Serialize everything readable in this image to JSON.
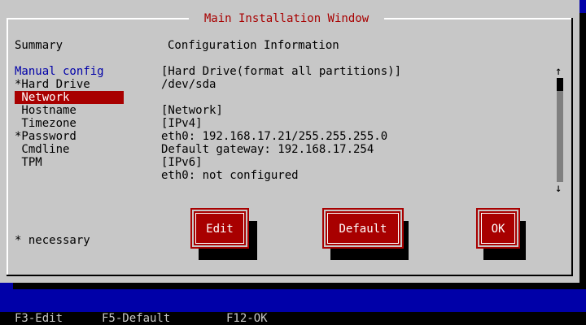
{
  "window": {
    "title": "Main Installation Window"
  },
  "headers": {
    "summary": "Summary",
    "config_info": "Configuration Information"
  },
  "summary_items": [
    {
      "label": "Manual config"
    },
    {
      "label": "*Hard Drive"
    },
    {
      "label": " Network"
    },
    {
      "label": " Hostname"
    },
    {
      "label": " Timezone"
    },
    {
      "label": "*Password"
    },
    {
      "label": " Cmdline"
    },
    {
      "label": " TPM"
    }
  ],
  "info_lines": [
    "[Hard Drive(format all partitions)]",
    "/dev/sda",
    "",
    "[Network]",
    "[IPv4]",
    "eth0: 192.168.17.21/255.255.255.0",
    "Default gateway: 192.168.17.254",
    "[IPv6]",
    "eth0: not configured"
  ],
  "scroll": {
    "up_arrow": "↑",
    "down_arrow": "↓",
    "position": 0
  },
  "necessary_note": "* necessary",
  "buttons": {
    "edit": "Edit",
    "default": "Default",
    "ok": "OK"
  },
  "footer": {
    "f3": "F3-Edit",
    "f5": "F5-Default",
    "f12": "F12-OK"
  },
  "colors": {
    "background": "#0000a8",
    "window": "#c7c7c7",
    "accent": "#a80000",
    "selected_text": "#ffffff"
  }
}
